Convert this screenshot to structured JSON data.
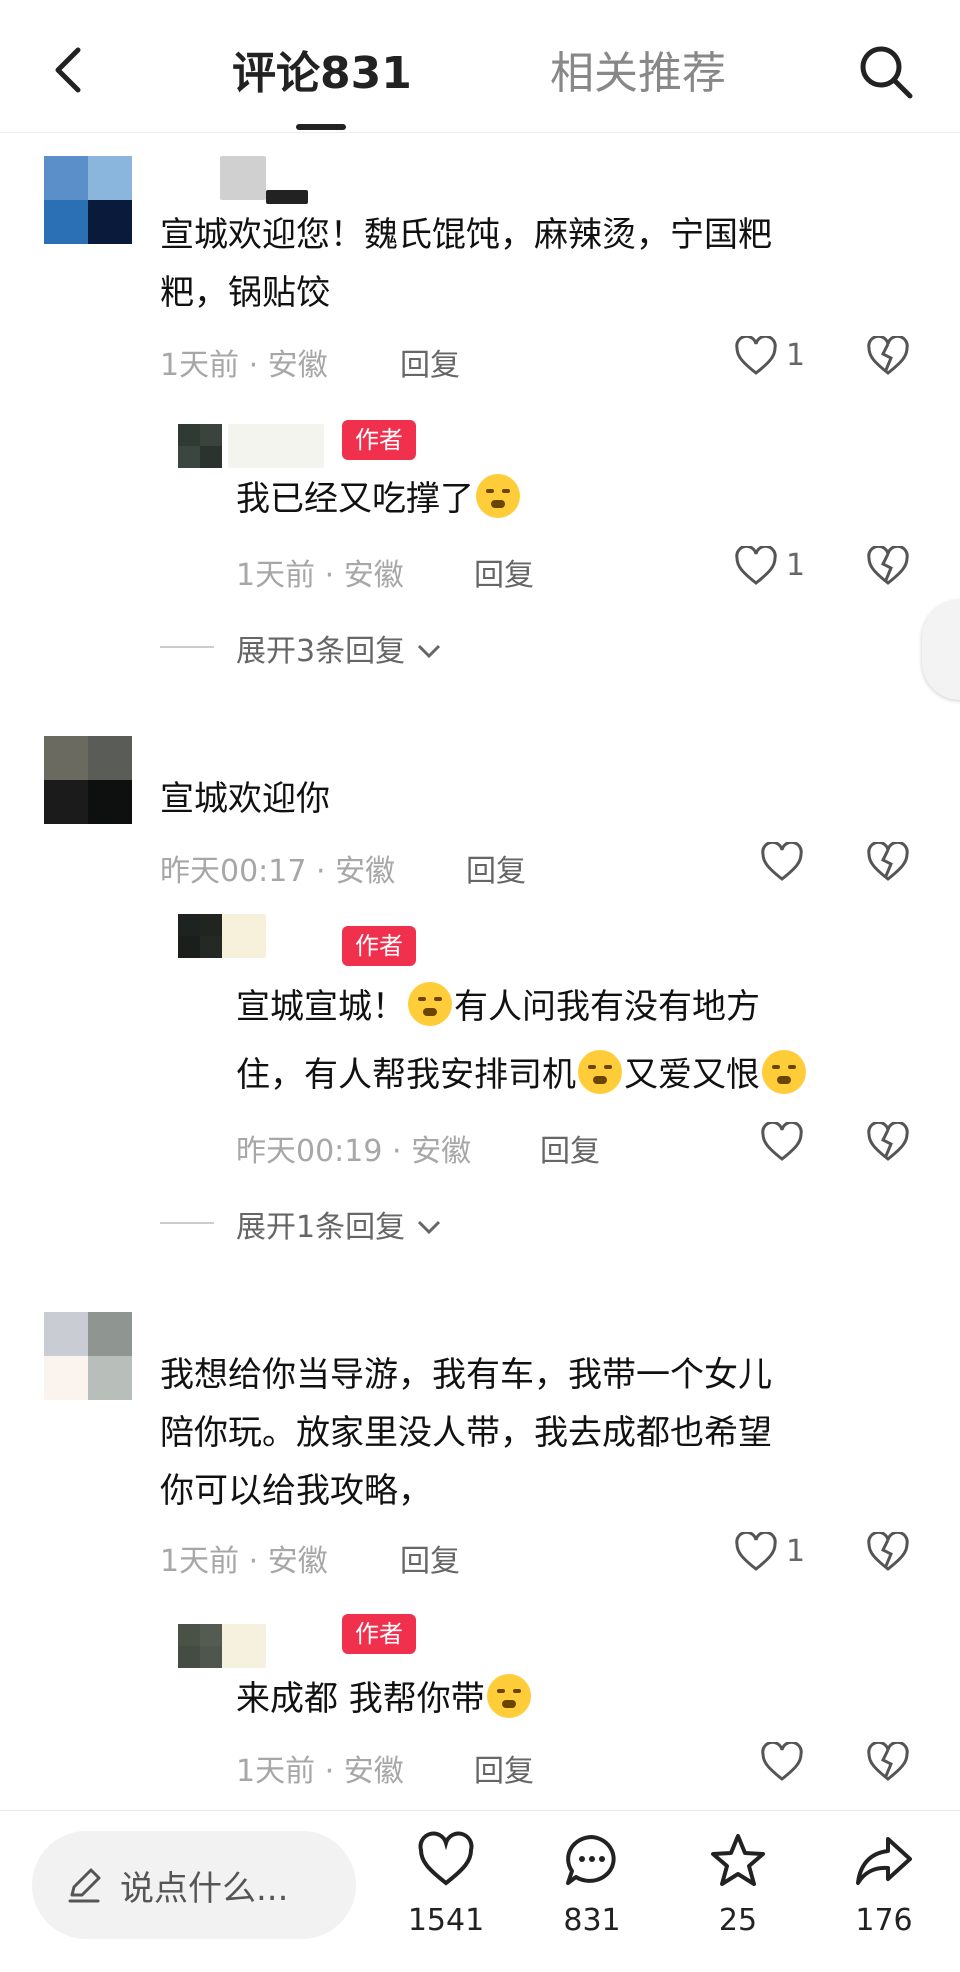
{
  "header": {
    "tab_comments": "评论831",
    "tab_related": "相关推荐"
  },
  "comments": [
    {
      "text_lines": [
        "宣城欢迎您！魏氏馄饨，麻辣烫，宁国粑",
        "粑，锅贴饺"
      ],
      "time": "1天前",
      "location": "安徽",
      "reply_label": "回复",
      "likes": "1",
      "avatar_colors": [
        "#5a8fc9",
        "#8ab6dd",
        "#2b6fb4",
        "#0a1a3a"
      ],
      "replies": [
        {
          "badge": "作者",
          "text": "我已经又吃撑了",
          "time": "1天前",
          "location": "安徽",
          "reply_label": "回复",
          "likes": "1"
        }
      ],
      "expand_label": "展开3条回复"
    },
    {
      "text_lines": [
        "宣城欢迎你"
      ],
      "time": "昨天00:17",
      "location": "安徽",
      "reply_label": "回复",
      "likes": "",
      "avatar_colors": [
        "#6b6a61",
        "#5a5d57",
        "#1b1b1b",
        "#0e0f0f"
      ],
      "replies": [
        {
          "badge": "作者",
          "text_line1": "宣城宣城！",
          "text_line1b": "有人问我有没有地方",
          "text_line2a": "住，有人帮我安排司机",
          "text_line2b": "又爱又恨",
          "time": "昨天00:19",
          "location": "安徽",
          "reply_label": "回复",
          "likes": ""
        }
      ],
      "expand_label": "展开1条回复"
    },
    {
      "text_lines": [
        "我想给你当导游，我有车，我带一个女儿",
        "陪你玩。放家里没人带，我去成都也希望",
        "你可以给我攻略，"
      ],
      "time": "1天前",
      "location": "安徽",
      "reply_label": "回复",
      "likes": "1",
      "avatar_colors": [
        "#c9cdd3",
        "#8f9691",
        "#fbf3ee",
        "#b8bfba"
      ],
      "replies": [
        {
          "badge": "作者",
          "text": "来成都 我帮你带",
          "time": "1天前",
          "location": "安徽",
          "reply_label": "回复",
          "likes": ""
        }
      ]
    }
  ],
  "meta_separator": "·",
  "bottom_bar": {
    "input_placeholder": "说点什么...",
    "like_count": "1541",
    "comment_count": "831",
    "favorite_count": "25",
    "share_count": "176"
  },
  "icons": {
    "back": "chevron-left-icon",
    "search": "search-icon",
    "like": "heart-icon",
    "dislike": "broken-heart-icon",
    "expand": "chevron-down-icon",
    "edit": "pencil-icon",
    "comment": "comment-bubble-icon",
    "favorite": "star-icon",
    "share": "share-arrow-icon"
  },
  "colors": {
    "author_badge": "#f0304d",
    "meta_text": "#a7a7a7"
  }
}
